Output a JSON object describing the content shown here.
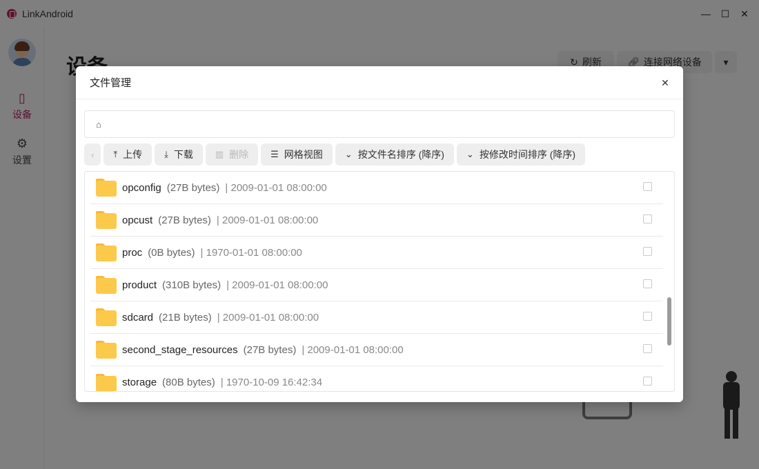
{
  "app": {
    "title": "LinkAndroid"
  },
  "window_controls": {
    "minimize": "—",
    "maximize": "☐",
    "close": "✕"
  },
  "sidebar": {
    "items": [
      {
        "label": "设备",
        "icon": "phone-icon",
        "active": true
      },
      {
        "label": "设置",
        "icon": "gear-icon",
        "active": false
      }
    ]
  },
  "background": {
    "heading": "设备",
    "refresh_label": "刷新",
    "connect_label": "连接网络设备"
  },
  "dialog": {
    "title": "文件管理",
    "toolbar": {
      "upload": "上传",
      "download": "下载",
      "delete": "删除",
      "grid_view": "网格视图",
      "sort_name": "按文件名排序 (降序)",
      "sort_time": "按修改时间排序 (降序)"
    },
    "files": [
      {
        "name": "opconfig",
        "size": "(27B bytes)",
        "date": "| 2009-01-01 08:00:00"
      },
      {
        "name": "opcust",
        "size": "(27B bytes)",
        "date": "| 2009-01-01 08:00:00"
      },
      {
        "name": "proc",
        "size": "(0B bytes)",
        "date": "| 1970-01-01 08:00:00"
      },
      {
        "name": "product",
        "size": "(310B bytes)",
        "date": "| 2009-01-01 08:00:00"
      },
      {
        "name": "sdcard",
        "size": "(21B bytes)",
        "date": "| 2009-01-01 08:00:00"
      },
      {
        "name": "second_stage_resources",
        "size": "(27B bytes)",
        "date": "| 2009-01-01 08:00:00"
      },
      {
        "name": "storage",
        "size": "(80B bytes)",
        "date": "| 1970-10-09 16:42:34"
      }
    ]
  },
  "colors": {
    "accent": "#b0215a",
    "folder": "#fcc94a"
  }
}
